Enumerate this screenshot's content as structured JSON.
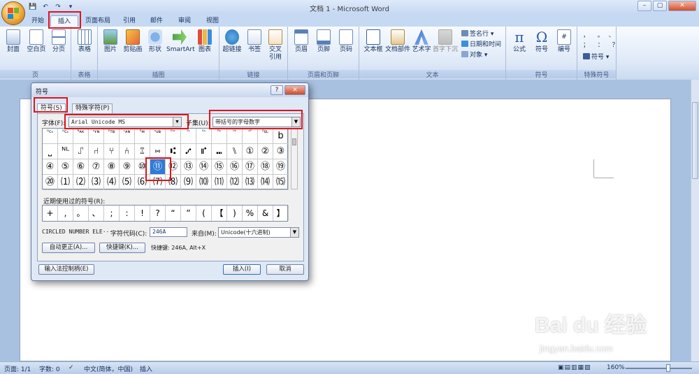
{
  "window": {
    "title": "文档 1 - Microsoft Word",
    "controls": [
      "–",
      "▢",
      "✕"
    ]
  },
  "qat": [
    "💾",
    "↶",
    "↷",
    "▾"
  ],
  "tabs": [
    "开始",
    "插入",
    "页面布局",
    "引用",
    "邮件",
    "审阅",
    "视图"
  ],
  "ribbon": {
    "groups": {
      "pages": "页",
      "tables": "表格",
      "illustrations": "插图",
      "links": "链接",
      "header_footer": "页眉和页脚",
      "text": "文本",
      "symbols": "符号",
      "special": "特殊符号"
    },
    "buttons": {
      "cover": "封面",
      "blank": "空白页",
      "break": "分页",
      "table": "表格",
      "picture": "图片",
      "clipart": "剪贴画",
      "shapes": "形状",
      "smartart": "SmartArt",
      "chart": "图表",
      "hyperlink": "超链接",
      "bookmark": "书签",
      "crossref": "交叉\n引用",
      "header": "页眉",
      "footer": "页脚",
      "pagenum": "页码",
      "textbox": "文本框",
      "quickparts": "文档部件",
      "wordart": "艺术字",
      "dropcap": "首字下沉",
      "signature": "签名行 ▾",
      "datetime": "日期和时间",
      "object": "对象 ▾",
      "equation": "公式",
      "symbol": "符号",
      "numbering": "编号",
      "special_symbol": "符号 ▾",
      "special_chars": "，  。 、\n；  ：  ？"
    }
  },
  "dialog": {
    "title": "符号",
    "help": "?",
    "close": "✕",
    "tabs": [
      "符号(S)",
      "特殊字符(P)"
    ],
    "font_label": "字体(F):",
    "font_value": "Arial Unicode MS",
    "subset_label": "子集(U):",
    "subset_value": "带括号的字母数字",
    "grid_rows": [
      [
        "ᴰᴄ₃",
        "ᴰᴄ₄",
        "ᴺᴀᴋ",
        "ˢʏɴ",
        "ᴱᴛʙ",
        "ᶜᴀɴ",
        "ᴱᴍ",
        "ˢᴜʙ",
        "ᴱˢᶜ",
        "ꟳˢ",
        "ᴳˢ",
        "ᴿˢ",
        "ᵁˢ",
        "ˢᴾ",
        "ᴰᴇʟ",
        "b"
      ],
      [
        "⎵",
        "ᴺᴸ",
        "⑀",
        "⑁",
        "⑂",
        "⑃",
        "⑄",
        "⑅",
        "⑆",
        "⑇",
        "⑈",
        "⑉",
        "⑊",
        "①",
        "②",
        "③"
      ],
      [
        "④",
        "⑤",
        "⑥",
        "⑦",
        "⑧",
        "⑨",
        "⑩",
        "⑪",
        "⑫",
        "⑬",
        "⑭",
        "⑮",
        "⑯",
        "⑰",
        "⑱",
        "⑲"
      ],
      [
        "⑳",
        "⑴",
        "⑵",
        "⑶",
        "⑷",
        "⑸",
        "⑹",
        "⑺",
        "⑻",
        "⑼",
        "⑽",
        "⑾",
        "⑿",
        "⒀",
        "⒁",
        "⒂"
      ]
    ],
    "recent_label": "近期使用过的符号(R):",
    "recent": [
      "+",
      ",",
      "。",
      "、",
      ";",
      ":",
      "!",
      "?",
      "“",
      "”",
      "(",
      "【",
      ")",
      "%",
      "&",
      "】"
    ],
    "char_name": "CIRCLED NUMBER ELE···",
    "code_label": "字符代码(C):",
    "code_value": "246A",
    "from_label": "来自(M):",
    "from_value": "Unicode(十六进制)",
    "autocorrect": "自动更正(A)...",
    "shortcut_btn": "快捷键(K)...",
    "shortcut_text": "快捷键: 246A, Alt+X",
    "ime_btn": "输入法控制柄(E)",
    "insert": "插入(I)",
    "cancel": "取消"
  },
  "status": {
    "page": "页面: 1/1",
    "words": "字数: 0",
    "lang": "中文(简体，中国)",
    "mode": "插入",
    "zoom": "160%"
  },
  "watermark": {
    "text": "Bai du 经验",
    "sub": "jingyan.baidu.com"
  },
  "colors": {
    "highlight": "#e0141e",
    "selection": "#2f7bd5",
    "ribbon": "#dde8f7"
  }
}
